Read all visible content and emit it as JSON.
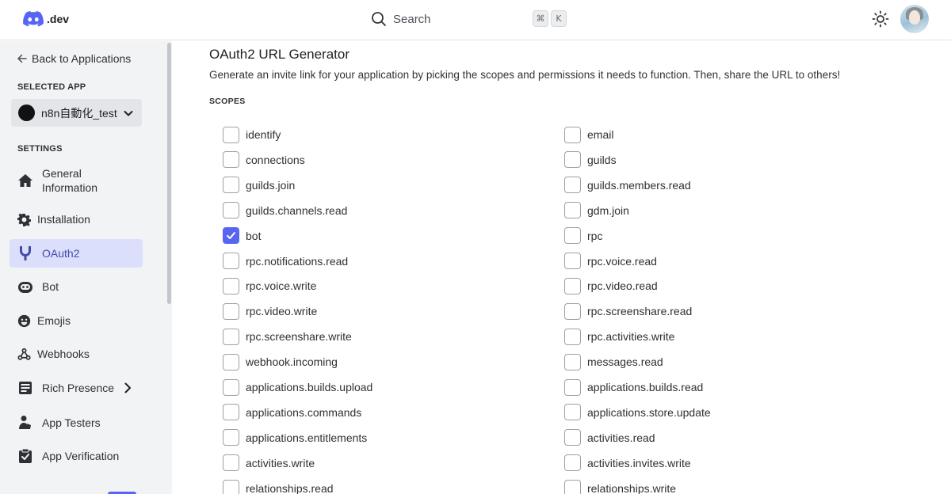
{
  "topbar": {
    "logo_text": ".dev",
    "search_label": "Search",
    "shortcut_keys": [
      "⌘",
      "K"
    ]
  },
  "sidebar": {
    "back_label": "Back to Applications",
    "selected_app_heading": "SELECTED APP",
    "selected_app_name": "n8n自動化_test",
    "settings_heading": "SETTINGS",
    "items": [
      {
        "label": "General Information",
        "icon": "home-icon",
        "active": false
      },
      {
        "label": "Installation",
        "icon": "gear-icon",
        "active": false
      },
      {
        "label": "OAuth2",
        "icon": "wrench-icon",
        "active": true
      },
      {
        "label": "Bot",
        "icon": "bot-icon",
        "active": false
      },
      {
        "label": "Emojis",
        "icon": "emoji-icon",
        "active": false
      },
      {
        "label": "Webhooks",
        "icon": "webhook-icon",
        "active": false
      },
      {
        "label": "Rich Presence",
        "icon": "rich-presence-icon",
        "active": false,
        "has_submenu": true
      },
      {
        "label": "App Testers",
        "icon": "user-icon",
        "active": false
      },
      {
        "label": "App Verification",
        "icon": "clipboard-check-icon",
        "active": false
      }
    ]
  },
  "main": {
    "title": "OAuth2 URL Generator",
    "description": "Generate an invite link for your application by picking the scopes and permissions it needs to function. Then, share the URL to others!",
    "scopes_heading": "SCOPES",
    "scopes_left": [
      {
        "label": "identify",
        "checked": false
      },
      {
        "label": "connections",
        "checked": false
      },
      {
        "label": "guilds.join",
        "checked": false
      },
      {
        "label": "guilds.channels.read",
        "checked": false
      },
      {
        "label": "bot",
        "checked": true
      },
      {
        "label": "rpc.notifications.read",
        "checked": false
      },
      {
        "label": "rpc.voice.write",
        "checked": false
      },
      {
        "label": "rpc.video.write",
        "checked": false
      },
      {
        "label": "rpc.screenshare.write",
        "checked": false
      },
      {
        "label": "webhook.incoming",
        "checked": false
      },
      {
        "label": "applications.builds.upload",
        "checked": false
      },
      {
        "label": "applications.commands",
        "checked": false
      },
      {
        "label": "applications.entitlements",
        "checked": false
      },
      {
        "label": "activities.write",
        "checked": false
      },
      {
        "label": "relationships.read",
        "checked": false
      }
    ],
    "scopes_right": [
      {
        "label": "email",
        "checked": false
      },
      {
        "label": "guilds",
        "checked": false
      },
      {
        "label": "guilds.members.read",
        "checked": false
      },
      {
        "label": "gdm.join",
        "checked": false
      },
      {
        "label": "rpc",
        "checked": false
      },
      {
        "label": "rpc.voice.read",
        "checked": false
      },
      {
        "label": "rpc.video.read",
        "checked": false
      },
      {
        "label": "rpc.screenshare.read",
        "checked": false
      },
      {
        "label": "rpc.activities.write",
        "checked": false
      },
      {
        "label": "messages.read",
        "checked": false
      },
      {
        "label": "applications.builds.read",
        "checked": false
      },
      {
        "label": "applications.store.update",
        "checked": false
      },
      {
        "label": "activities.read",
        "checked": false
      },
      {
        "label": "activities.invites.write",
        "checked": false
      },
      {
        "label": "relationships.write",
        "checked": false
      }
    ]
  },
  "colors": {
    "accent": "#5865f2",
    "active_nav_bg": "#dcdffb",
    "sidebar_bg": "#f2f3f5"
  }
}
